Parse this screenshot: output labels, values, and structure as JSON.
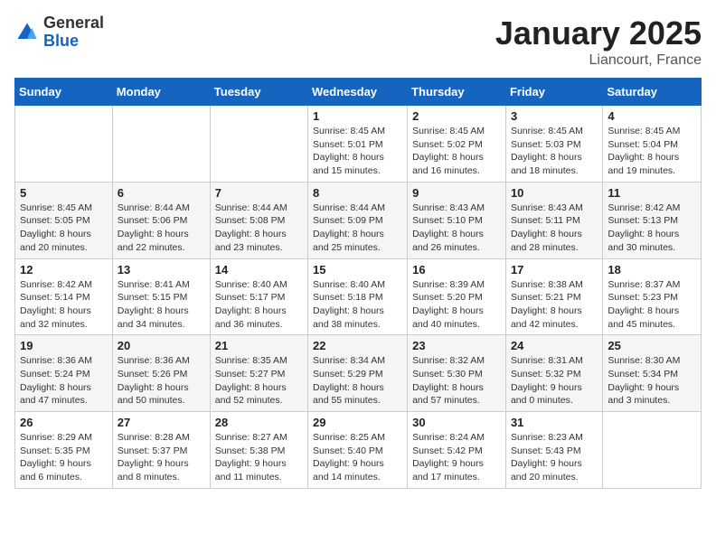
{
  "logo": {
    "general": "General",
    "blue": "Blue"
  },
  "title": "January 2025",
  "location": "Liancourt, France",
  "days_of_week": [
    "Sunday",
    "Monday",
    "Tuesday",
    "Wednesday",
    "Thursday",
    "Friday",
    "Saturday"
  ],
  "weeks": [
    [
      {
        "day": "",
        "info": ""
      },
      {
        "day": "",
        "info": ""
      },
      {
        "day": "",
        "info": ""
      },
      {
        "day": "1",
        "info": "Sunrise: 8:45 AM\nSunset: 5:01 PM\nDaylight: 8 hours\nand 15 minutes."
      },
      {
        "day": "2",
        "info": "Sunrise: 8:45 AM\nSunset: 5:02 PM\nDaylight: 8 hours\nand 16 minutes."
      },
      {
        "day": "3",
        "info": "Sunrise: 8:45 AM\nSunset: 5:03 PM\nDaylight: 8 hours\nand 18 minutes."
      },
      {
        "day": "4",
        "info": "Sunrise: 8:45 AM\nSunset: 5:04 PM\nDaylight: 8 hours\nand 19 minutes."
      }
    ],
    [
      {
        "day": "5",
        "info": "Sunrise: 8:45 AM\nSunset: 5:05 PM\nDaylight: 8 hours\nand 20 minutes."
      },
      {
        "day": "6",
        "info": "Sunrise: 8:44 AM\nSunset: 5:06 PM\nDaylight: 8 hours\nand 22 minutes."
      },
      {
        "day": "7",
        "info": "Sunrise: 8:44 AM\nSunset: 5:08 PM\nDaylight: 8 hours\nand 23 minutes."
      },
      {
        "day": "8",
        "info": "Sunrise: 8:44 AM\nSunset: 5:09 PM\nDaylight: 8 hours\nand 25 minutes."
      },
      {
        "day": "9",
        "info": "Sunrise: 8:43 AM\nSunset: 5:10 PM\nDaylight: 8 hours\nand 26 minutes."
      },
      {
        "day": "10",
        "info": "Sunrise: 8:43 AM\nSunset: 5:11 PM\nDaylight: 8 hours\nand 28 minutes."
      },
      {
        "day": "11",
        "info": "Sunrise: 8:42 AM\nSunset: 5:13 PM\nDaylight: 8 hours\nand 30 minutes."
      }
    ],
    [
      {
        "day": "12",
        "info": "Sunrise: 8:42 AM\nSunset: 5:14 PM\nDaylight: 8 hours\nand 32 minutes."
      },
      {
        "day": "13",
        "info": "Sunrise: 8:41 AM\nSunset: 5:15 PM\nDaylight: 8 hours\nand 34 minutes."
      },
      {
        "day": "14",
        "info": "Sunrise: 8:40 AM\nSunset: 5:17 PM\nDaylight: 8 hours\nand 36 minutes."
      },
      {
        "day": "15",
        "info": "Sunrise: 8:40 AM\nSunset: 5:18 PM\nDaylight: 8 hours\nand 38 minutes."
      },
      {
        "day": "16",
        "info": "Sunrise: 8:39 AM\nSunset: 5:20 PM\nDaylight: 8 hours\nand 40 minutes."
      },
      {
        "day": "17",
        "info": "Sunrise: 8:38 AM\nSunset: 5:21 PM\nDaylight: 8 hours\nand 42 minutes."
      },
      {
        "day": "18",
        "info": "Sunrise: 8:37 AM\nSunset: 5:23 PM\nDaylight: 8 hours\nand 45 minutes."
      }
    ],
    [
      {
        "day": "19",
        "info": "Sunrise: 8:36 AM\nSunset: 5:24 PM\nDaylight: 8 hours\nand 47 minutes."
      },
      {
        "day": "20",
        "info": "Sunrise: 8:36 AM\nSunset: 5:26 PM\nDaylight: 8 hours\nand 50 minutes."
      },
      {
        "day": "21",
        "info": "Sunrise: 8:35 AM\nSunset: 5:27 PM\nDaylight: 8 hours\nand 52 minutes."
      },
      {
        "day": "22",
        "info": "Sunrise: 8:34 AM\nSunset: 5:29 PM\nDaylight: 8 hours\nand 55 minutes."
      },
      {
        "day": "23",
        "info": "Sunrise: 8:32 AM\nSunset: 5:30 PM\nDaylight: 8 hours\nand 57 minutes."
      },
      {
        "day": "24",
        "info": "Sunrise: 8:31 AM\nSunset: 5:32 PM\nDaylight: 9 hours\nand 0 minutes."
      },
      {
        "day": "25",
        "info": "Sunrise: 8:30 AM\nSunset: 5:34 PM\nDaylight: 9 hours\nand 3 minutes."
      }
    ],
    [
      {
        "day": "26",
        "info": "Sunrise: 8:29 AM\nSunset: 5:35 PM\nDaylight: 9 hours\nand 6 minutes."
      },
      {
        "day": "27",
        "info": "Sunrise: 8:28 AM\nSunset: 5:37 PM\nDaylight: 9 hours\nand 8 minutes."
      },
      {
        "day": "28",
        "info": "Sunrise: 8:27 AM\nSunset: 5:38 PM\nDaylight: 9 hours\nand 11 minutes."
      },
      {
        "day": "29",
        "info": "Sunrise: 8:25 AM\nSunset: 5:40 PM\nDaylight: 9 hours\nand 14 minutes."
      },
      {
        "day": "30",
        "info": "Sunrise: 8:24 AM\nSunset: 5:42 PM\nDaylight: 9 hours\nand 17 minutes."
      },
      {
        "day": "31",
        "info": "Sunrise: 8:23 AM\nSunset: 5:43 PM\nDaylight: 9 hours\nand 20 minutes."
      },
      {
        "day": "",
        "info": ""
      }
    ]
  ]
}
